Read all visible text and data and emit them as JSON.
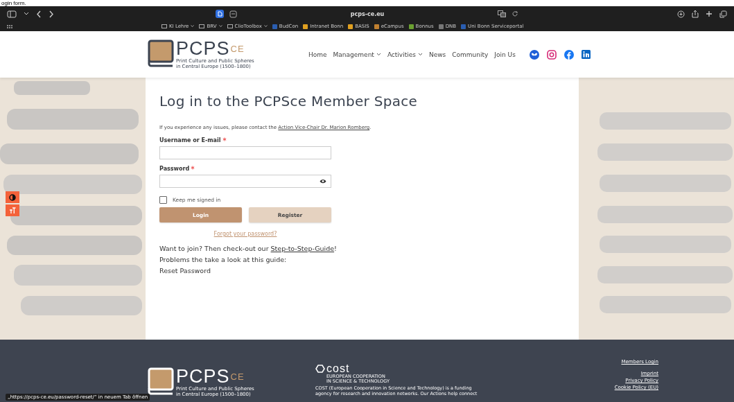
{
  "caption": "ogin form.",
  "browser": {
    "address": "pcps-ce.eu",
    "bookmarks": [
      {
        "label": "KI Lehre",
        "kind": "folder"
      },
      {
        "label": "BRV",
        "kind": "folder"
      },
      {
        "label": "ClioToolbox",
        "kind": "folder"
      },
      {
        "label": "BudCon",
        "kind": "site",
        "color": "#2a5db0"
      },
      {
        "label": "Intranet Bonn",
        "kind": "site",
        "color": "#e0a020"
      },
      {
        "label": "BASIS",
        "kind": "site",
        "color": "#e0a020"
      },
      {
        "label": "eCampus",
        "kind": "site",
        "color": "#c08030"
      },
      {
        "label": "Bonnus",
        "kind": "site",
        "color": "#6aa030"
      },
      {
        "label": "DNB",
        "kind": "site",
        "color": "#777777"
      },
      {
        "label": "Uni Bonn Serviceportal",
        "kind": "site",
        "color": "#2a5db0"
      }
    ]
  },
  "header": {
    "logo": {
      "name": "PCPS",
      "sup": "CE",
      "tagline": [
        "Print Culture and Public Spheres",
        "in Central Europe (1500–1800)"
      ]
    },
    "nav": [
      {
        "label": "Home",
        "dropdown": false
      },
      {
        "label": "Management",
        "dropdown": true
      },
      {
        "label": "Activities",
        "dropdown": true
      },
      {
        "label": "News",
        "dropdown": false
      },
      {
        "label": "Community",
        "dropdown": false
      },
      {
        "label": "Join Us",
        "dropdown": false
      }
    ],
    "social": [
      {
        "kind": "butterfly"
      },
      {
        "kind": "instagram"
      },
      {
        "kind": "facebook"
      },
      {
        "kind": "linkedin"
      }
    ]
  },
  "tools": [
    {
      "kind": "contrast"
    },
    {
      "kind": "text-size"
    }
  ],
  "form": {
    "title": "Log in to the PCPSce Member Space",
    "notice": {
      "text": "If you experience any issues, please contact the ",
      "link": "Action Vice-Chair Dr. Marion Romberg",
      "end": "."
    },
    "fields": [
      {
        "label": "Username or E-mail",
        "required": true,
        "kind": "text"
      },
      {
        "label": "Password",
        "required": true,
        "kind": "password"
      }
    ],
    "remember": {
      "label": "Keep me signed in",
      "checked": false
    },
    "buttons": [
      {
        "label": "Login",
        "kind": "primary"
      },
      {
        "label": "Register",
        "kind": "secondary"
      }
    ],
    "forgot": "Forgot your password?",
    "join": {
      "text": "Want to join? Then check-out our ",
      "link": "Step-to-Step-Guide",
      "end": "!"
    },
    "lines": [
      "Problems the take a look at this guide:",
      "Reset Password"
    ]
  },
  "footer": {
    "logo": {
      "name": "PCPS",
      "sup": "CE",
      "tagline": [
        "Print Culture and Public Spheres",
        "in Central Europe (1500–1800)"
      ]
    },
    "cost": {
      "name": "cost",
      "sub": [
        "EUROPEAN COOPERATION",
        "IN SCIENCE & TECHNOLOGY"
      ],
      "text": [
        "COST (European Cooperation in Science and Technology) is a funding",
        "agency for research and innovation networks. Our Actions help connect"
      ]
    },
    "links": [
      "Members Login",
      "Imprint",
      "Privacy Policy",
      "Cookie Policy (EU)"
    ]
  },
  "status_url": "„https://pcps-ce.eu/password-reset/“ in neuem Tab öffnen"
}
